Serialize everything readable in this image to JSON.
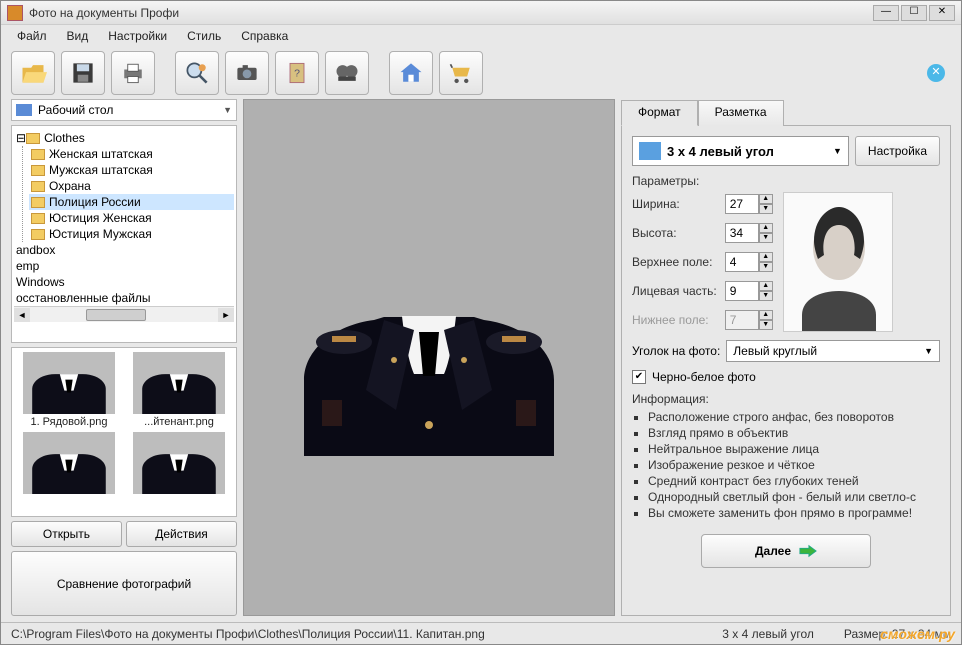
{
  "window": {
    "title": "Фото на документы Профи"
  },
  "menu": {
    "file": "Файл",
    "view": "Вид",
    "settings": "Настройки",
    "style": "Стиль",
    "help": "Справка"
  },
  "toolbar_icons": [
    "open",
    "save",
    "print",
    "zoom",
    "camera",
    "poster",
    "video",
    "house",
    "cart"
  ],
  "sidebar": {
    "location": "Рабочий стол",
    "tree": {
      "root": "Clothes",
      "children": [
        "Женская штатская",
        "Мужская штатская",
        "Охрана",
        "Полиция России",
        "Юстиция Женская",
        "Юстиция Мужская"
      ],
      "selected_index": 3,
      "siblings": [
        "andbox",
        "emp",
        "Windows",
        "осстановленные файлы"
      ]
    },
    "thumbs": [
      {
        "caption": "1. Рядовой.png"
      },
      {
        "caption": "...йтенант.png"
      },
      {
        "caption": ""
      },
      {
        "caption": ""
      }
    ],
    "open_btn": "Открыть",
    "actions_btn": "Действия",
    "compare_btn": "Сравнение фотографий"
  },
  "tabs": {
    "format": "Формат",
    "layout": "Разметка",
    "active": 0
  },
  "preset": {
    "label": "3 x 4 левый угол",
    "settings_btn": "Настройка"
  },
  "params": {
    "title": "Параметры:",
    "width_label": "Ширина:",
    "width": "27",
    "height_label": "Высота:",
    "height": "34",
    "top_label": "Верхнее поле:",
    "top": "4",
    "face_label": "Лицевая часть:",
    "face": "9",
    "bottom_label": "Нижнее поле:",
    "bottom": "7"
  },
  "corner": {
    "label": "Уголок на фото:",
    "value": "Левый круглый"
  },
  "bw": {
    "label": "Черно-белое фото",
    "checked": true
  },
  "info": {
    "title": "Информация:",
    "items": [
      "Расположение строго анфас, без поворотов",
      "Взгляд прямо в объектив",
      "Нейтральное выражение лица",
      "Изображение резкое и чёткое",
      "Средний контраст без глубоких теней",
      "Однородный светлый фон - белый или светло-с",
      "Вы сможете заменить фон прямо в программе!"
    ]
  },
  "next_btn": "Далее",
  "status": {
    "path": "C:\\Program Files\\Фото на документы Профи\\Clothes\\Полиция России\\11. Капитан.png",
    "preset": "3 x 4 левый угол",
    "size": "Размер: 27 x 34 мм"
  },
  "watermark": "сможем.ру"
}
